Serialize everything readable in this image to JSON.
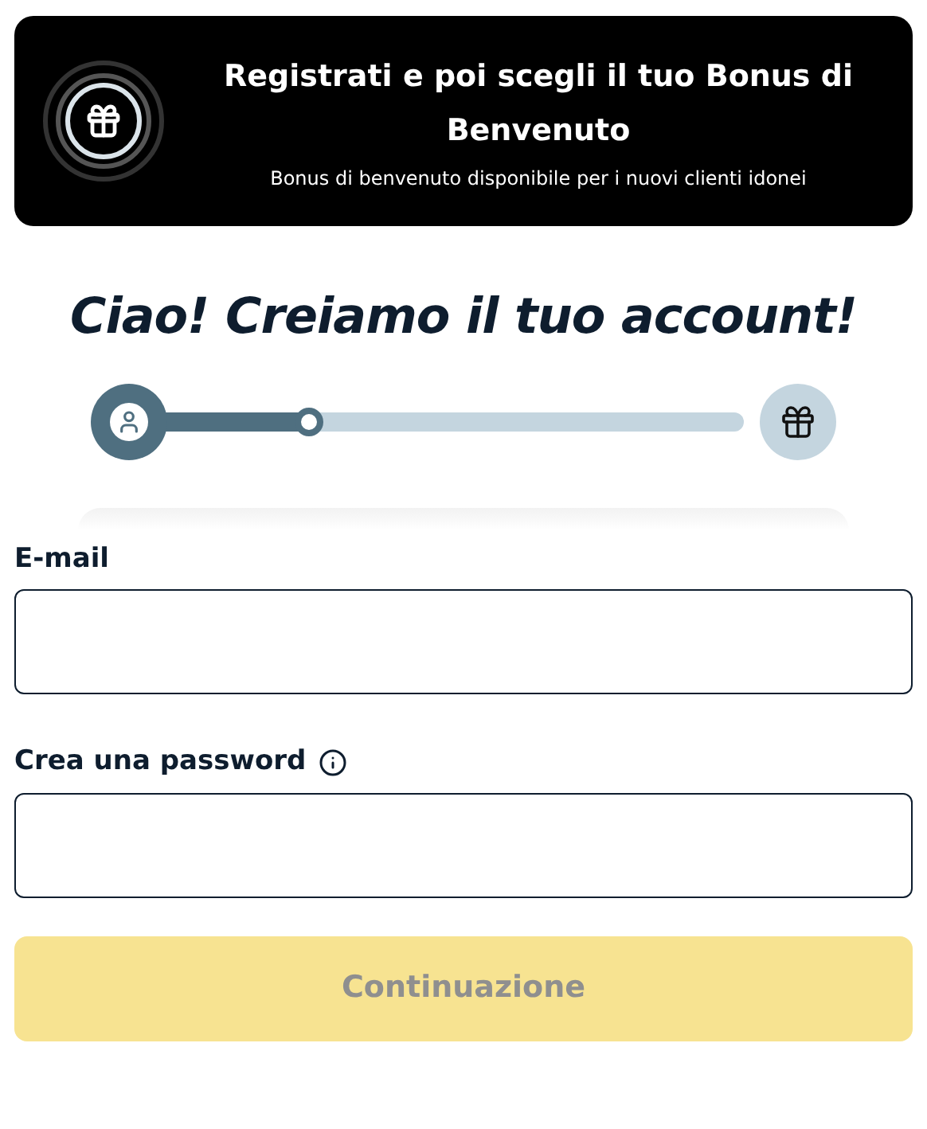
{
  "banner": {
    "title": "Registrati e poi scegli il tuo Bonus di Benvenuto",
    "subtitle": "Bonus di benvenuto disponibile per i nuovi clienti idonei"
  },
  "heading": "Ciao! Creiamo il tuo account!",
  "progress": {
    "level": 0.25
  },
  "fields": [
    {
      "label": "E-mail",
      "info": false
    },
    {
      "label": "Crea una password",
      "info": true
    }
  ],
  "submit": {
    "label": "Continuazione",
    "disabled": true
  }
}
